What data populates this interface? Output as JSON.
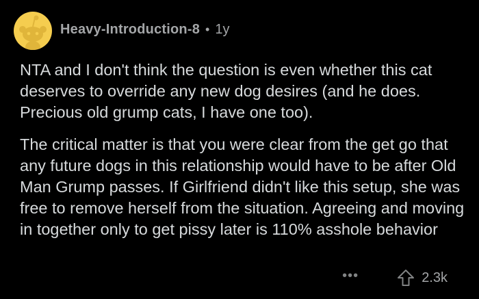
{
  "comment": {
    "author": "Heavy-Introduction-8",
    "separator": "•",
    "age": "1y",
    "paragraphs": [
      "NTA and I don't think the question is even whether this cat deserves to override any new dog desires (and he does. Precious old grump cats, I have one too).",
      "The critical matter is that you were clear from the get go that any future dogs in this relationship would have to be after Old Man Grump passes. If Girlfriend didn't like this setup, she was free to remove herself from the situation. Agreeing and moving in together only to get pissy later is 110% asshole behavior"
    ],
    "more_label": "•••",
    "score": "2.3k",
    "avatar_icon": "snoo-avatar-icon",
    "upvote_icon": "upvote-arrow-icon"
  },
  "colors": {
    "background": "#000000",
    "text": "#d7dadc",
    "meta": "#a4a6a8",
    "avatar": "#f5cd4f"
  }
}
